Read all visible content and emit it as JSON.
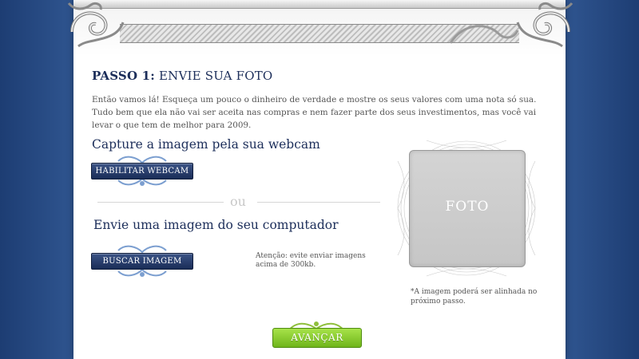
{
  "header": {
    "title_bold": "PASSO 1:",
    "title_rest": " ENVIE SUA FOTO",
    "intro": "Então vamos lá! Esqueça um pouco o dinheiro de verdade e mostre os seus valores com uma nota só sua. Tudo bem que ela não vai ser aceita nas compras e nem fazer parte dos seus investimentos, mas você vai levar o que tem de melhor para 2009."
  },
  "webcam": {
    "heading": "Capture a imagem pela sua webcam",
    "button_label": "HABILITAR WEBCAM"
  },
  "divider": {
    "label": "ou"
  },
  "upload": {
    "heading": "Envie uma imagem do seu computador",
    "button_label": "BUSCAR IMAGEM",
    "warning": "Atenção: evite enviar imagens acima de 300kb."
  },
  "photo": {
    "label": "FOTO",
    "note": "*A imagem poderá ser alinhada no próximo passo."
  },
  "footer": {
    "next_label": "AVANÇAR"
  },
  "icons": [
    "scroll-ornament-icon",
    "flourish-icon",
    "guilloche-frame-icon"
  ],
  "colors": {
    "background": "#2d528c",
    "title": "#1c2e5a",
    "button": "#1a2d57",
    "next_button": "#6fb51a",
    "photo_placeholder": "#cfcfcf"
  }
}
